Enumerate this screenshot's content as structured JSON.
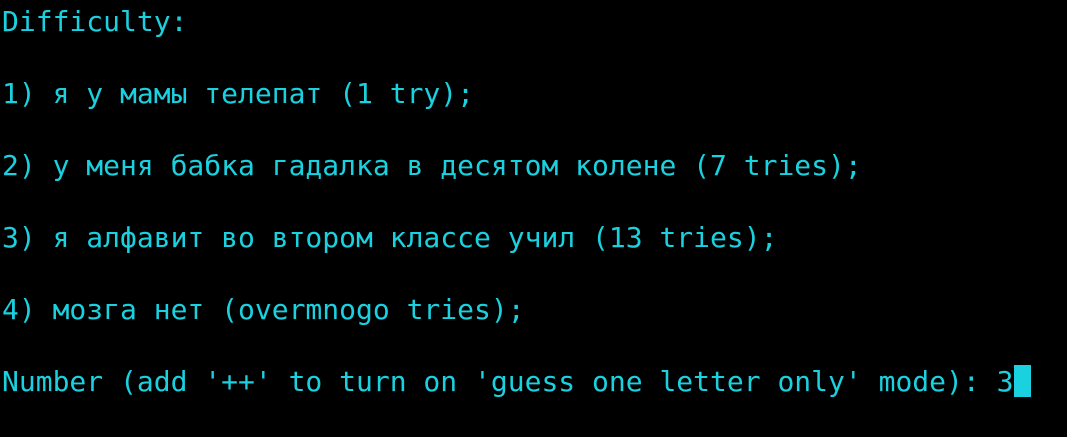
{
  "terminal": {
    "foreground": "#1ad1e0",
    "background": "#000000",
    "lines": [
      "Difficulty:",
      "1) я у мамы телепат (1 try);",
      "2) у меня бабка гадалка в десятом колене (7 tries);",
      "3) я алфавит во втором классе учил (13 tries);",
      "4) мозга нет (overmnogo tries);"
    ],
    "prompt": "Number (add '++' to turn on 'guess one letter only' mode): ",
    "input_value": "3",
    "cursor": "block-cursor"
  }
}
